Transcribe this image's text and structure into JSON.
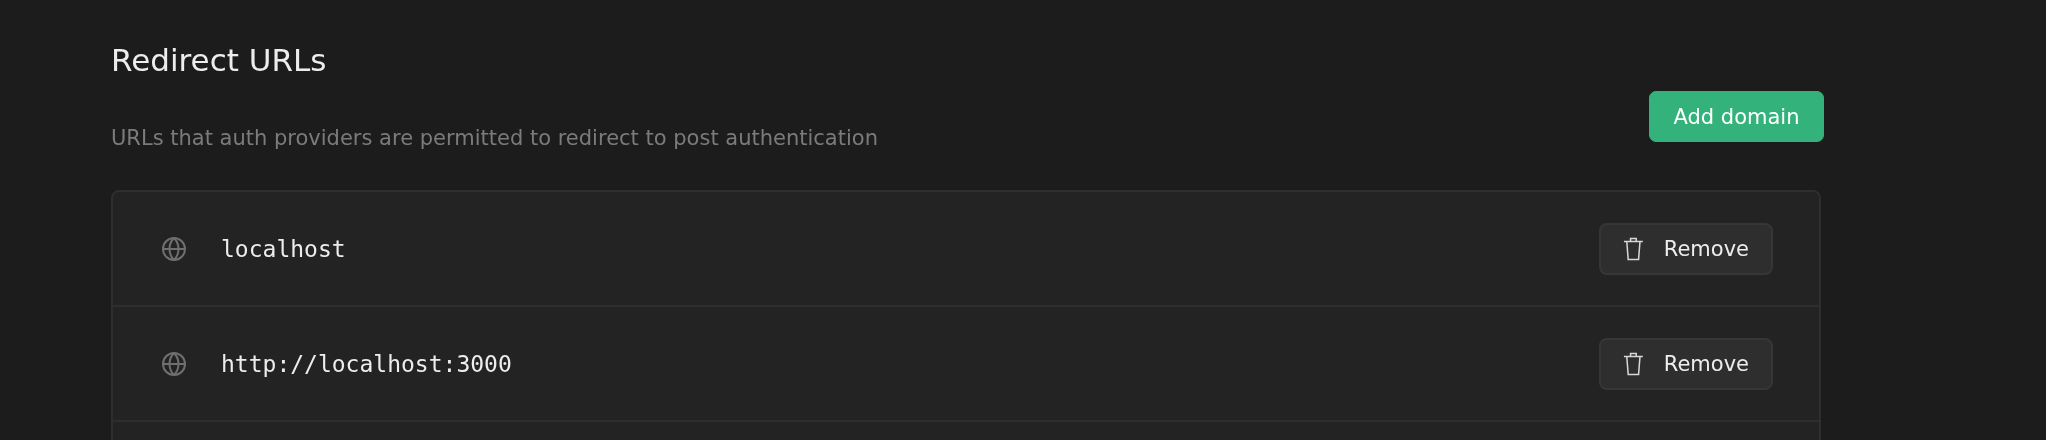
{
  "header": {
    "title": "Redirect URLs",
    "description": "URLs that auth providers are permitted to redirect to post authentication",
    "add_button": "Add domain"
  },
  "urls": [
    {
      "url": "localhost",
      "action": "Remove"
    },
    {
      "url": "http://localhost:3000",
      "action": "Remove"
    }
  ]
}
